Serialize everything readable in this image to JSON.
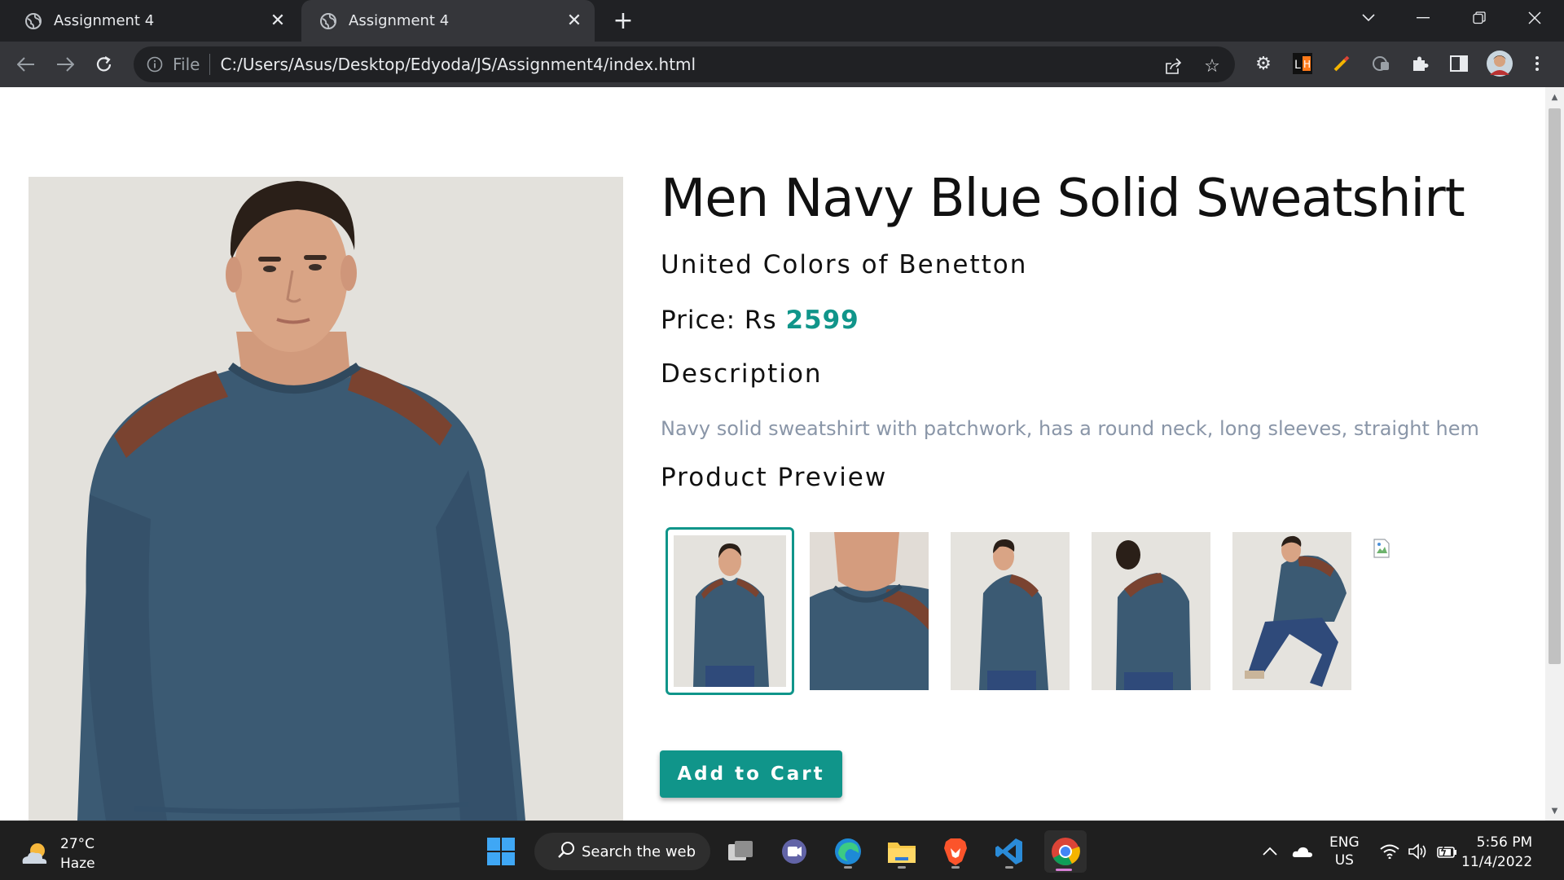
{
  "browser": {
    "tabs": [
      {
        "title": "Assignment 4",
        "active": false
      },
      {
        "title": "Assignment 4",
        "active": true
      }
    ],
    "omnibox": {
      "scheme_label": "File",
      "url": "C:/Users/Asus/Desktop/Edyoda/JS/Assignment4/index.html"
    }
  },
  "product": {
    "title": "Men Navy Blue Solid Sweatshirt",
    "brand": "United Colors of Benetton",
    "price_label": "Price: Rs ",
    "price_value": "2599",
    "description_heading": "Description",
    "description": "Navy solid sweatshirt with patchwork, has a round neck, long sleeves, straight hem",
    "preview_heading": "Product Preview",
    "selected_preview_index": 0,
    "add_to_cart_label": "Add to Cart"
  },
  "colors": {
    "accent": "#10958a",
    "sweatshirt": "#3b5a73",
    "patch": "#7a4330"
  },
  "taskbar": {
    "weather_temp": "27°C",
    "weather_desc": "Haze",
    "search_label": "Search the web",
    "lang_1": "ENG",
    "lang_2": "US",
    "time": "5:56 PM",
    "date": "11/4/2022"
  }
}
